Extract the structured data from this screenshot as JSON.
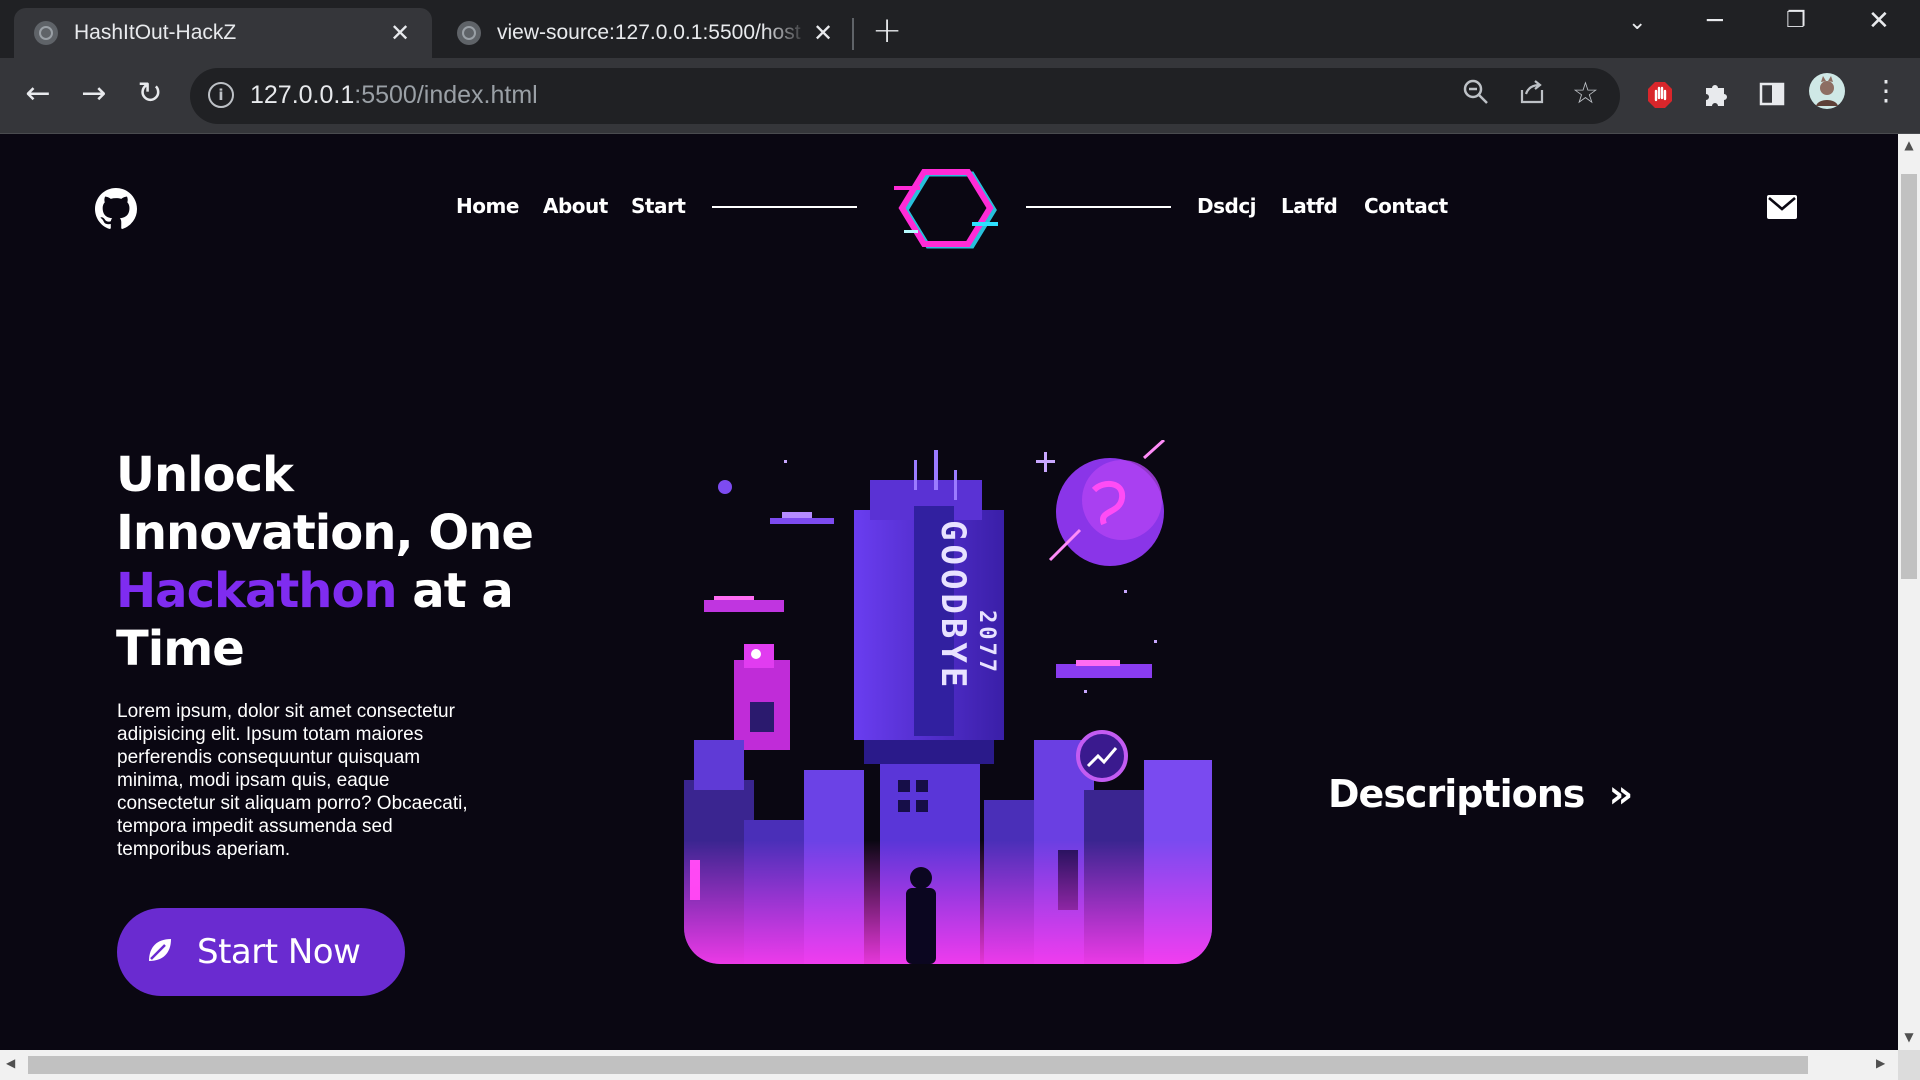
{
  "browser": {
    "tabs": [
      {
        "title": "HashItOut-HackZ",
        "active": true
      },
      {
        "title": "view-source:127.0.0.1:5500/host",
        "active": false
      }
    ],
    "url_host": "127.0.0.1",
    "url_path": ":5500/index.html"
  },
  "nav": {
    "left_links": [
      "Home",
      "About",
      "Start"
    ],
    "right_links": [
      "Dsdcj",
      "Latfd",
      "Contact"
    ]
  },
  "hero": {
    "title_line1": "Unlock",
    "title_line2": "Innovation, One",
    "title_accent": "Hackathon",
    "title_after_accent": " at a",
    "title_line4": "Time",
    "description": "Lorem ipsum, dolor sit amet consectetur adipisicing elit. Ipsum totam maiores perferendis consequuntur quisquam minima, modi ipsam quis, eaque consectetur sit aliquam porro? Obcaecati, tempora impedit assumenda sed temporibus aperiam.",
    "cta_label": "Start Now",
    "accent_color": "#7f2cf0",
    "button_color": "#6a2bd0"
  },
  "side": {
    "descriptions_label": "Descriptions",
    "descriptions_arrow": "»"
  },
  "art": {
    "sign_text": "GOODBYE",
    "sign_year": "2077"
  }
}
